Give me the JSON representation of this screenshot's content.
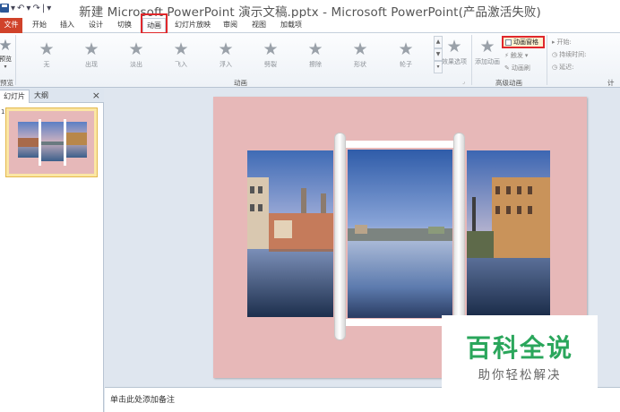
{
  "window": {
    "title": "新建 Microsoft PowerPoint 演示文稿.pptx - Microsoft PowerPoint(产品激活失败)",
    "qat": [
      "▾",
      "↶",
      "▾",
      "↷",
      "|",
      "▾"
    ]
  },
  "tabs": [
    "文件",
    "开始",
    "插入",
    "设计",
    "切换",
    "动画",
    "幻灯片放映",
    "审阅",
    "视图",
    "加载项"
  ],
  "ribbon": {
    "preview": {
      "label": "预览",
      "group": "预览"
    },
    "effects": [
      "无",
      "出现",
      "淡出",
      "飞入",
      "浮入",
      "劈裂",
      "擦除",
      "形状",
      "轮子"
    ],
    "effect_options": "效果选项",
    "animation_group_label": "动画",
    "add_animation": "添加动画",
    "animation_pane": "动画窗格",
    "trigger": "触发",
    "animation_painter": "动画刷",
    "advanced_group_label": "高级动画",
    "timing": {
      "start": "开始:",
      "duration": "持续时间:",
      "delay": "延迟:",
      "group_label": "计"
    }
  },
  "left_pane": {
    "tab_slides": "幻灯片",
    "tab_outline": "大纲",
    "close": "×",
    "slide_number": "1"
  },
  "notes": {
    "placeholder": "单击此处添加备注"
  },
  "watermark": {
    "title": "百科全说",
    "subtitle": "助你轻松解决"
  },
  "colors": {
    "file_tab": "#d0422a",
    "highlight": "#e0282c",
    "slide_bg": "#e7b8b8",
    "watermark_green": "#2aa65b"
  }
}
